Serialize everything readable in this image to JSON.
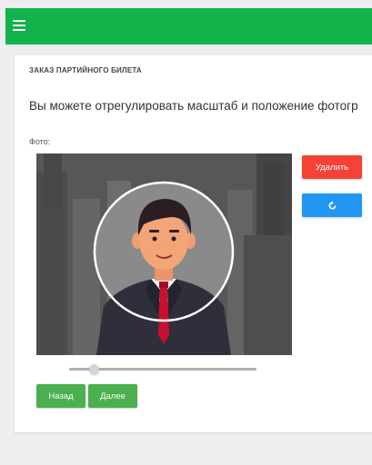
{
  "header": {
    "menu_icon": "hamburger-menu-icon",
    "color": "#13b34b"
  },
  "page": {
    "title": "ЗАКАЗ ПАРТИЙНОГО БИЛЕТА",
    "instruction": "Вы можете отрегулировать масштаб и положение фотогр",
    "photo_label": "Фото:"
  },
  "photo_editor": {
    "zoom_fraction": 0.13,
    "crop_shape": "circle"
  },
  "buttons": {
    "delete_label": "Удалить",
    "rotate_icon": "rotate-icon",
    "back_label": "Назад",
    "next_label": "Далее"
  },
  "colors": {
    "delete": "#f44336",
    "rotate": "#2196f3",
    "nav": "#4caf50"
  }
}
